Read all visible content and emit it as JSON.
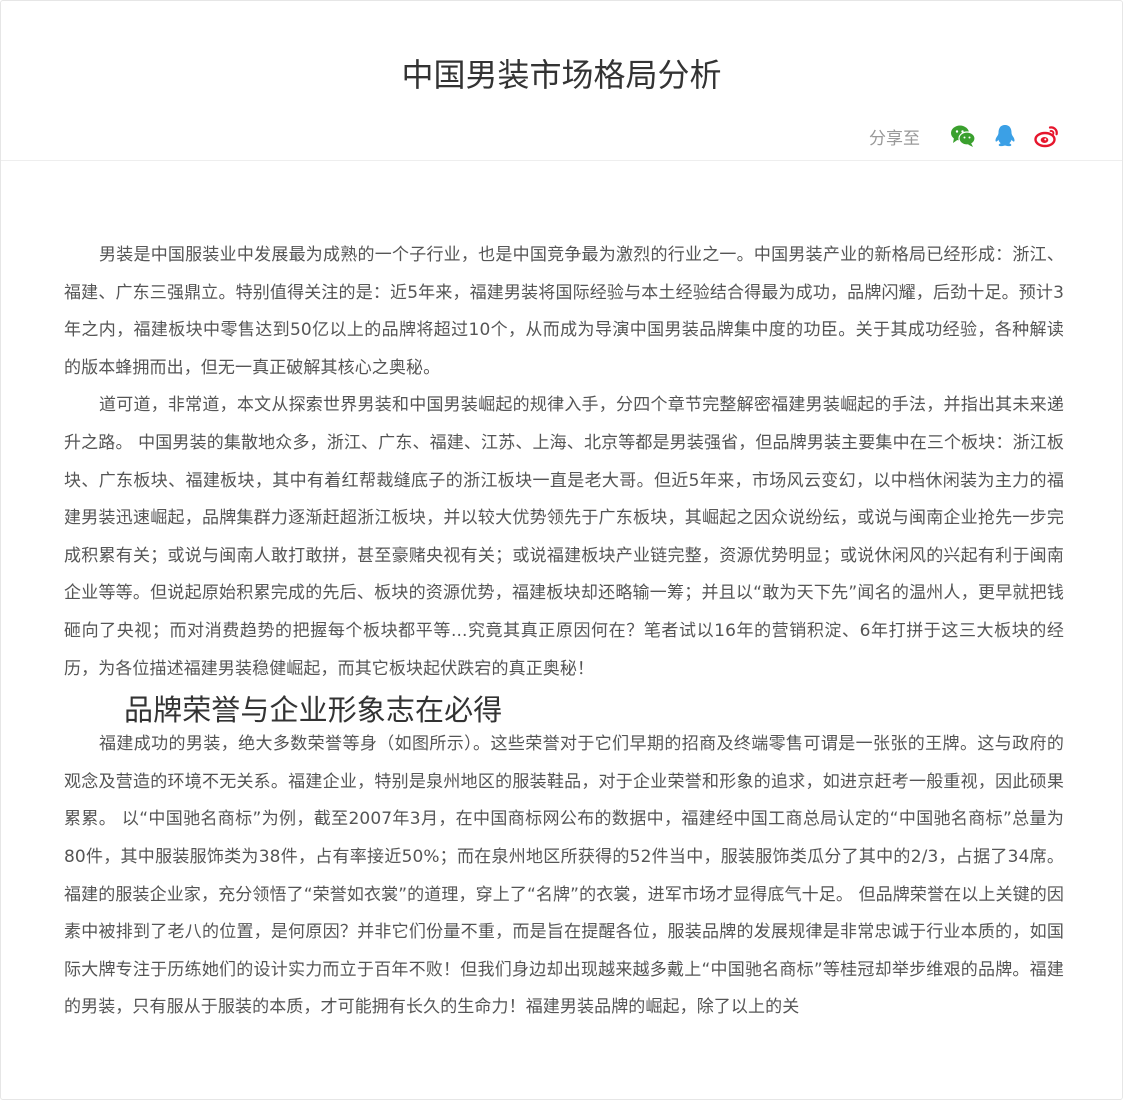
{
  "article": {
    "title": "中国男装市场格局分析",
    "share_label": "分享至",
    "paragraphs": [
      "男装是中国服装业中发展最为成熟的一个子行业，也是中国竞争最为激烈的行业之一。中国男装产业的新格局已经形成：浙江、福建、广东三强鼎立。特别值得关注的是：近5年来，福建男装将国际经验与本土经验结合得最为成功，品牌闪耀，后劲十足。预计3年之内，福建板块中零售达到50亿以上的品牌将超过10个，从而成为导演中国男装品牌集中度的功臣。关于其成功经验，各种解读的版本蜂拥而出，但无一真正破解其核心之奥秘。",
      "道可道，非常道，本文从探索世界男装和中国男装崛起的规律入手，分四个章节完整解密福建男装崛起的手法，并指出其未来递升之路。 中国男装的集散地众多，浙江、广东、福建、江苏、上海、北京等都是男装强省，但品牌男装主要集中在三个板块：浙江板块、广东板块、福建板块，其中有着红帮裁缝底子的浙江板块一直是老大哥。但近5年来，市场风云变幻，以中档休闲装为主力的福建男装迅速崛起，品牌集群力逐渐赶超浙江板块，并以较大优势领先于广东板块，其崛起之因众说纷纭，或说与闽南企业抢先一步完成积累有关；或说与闽南人敢打敢拼，甚至豪赌央视有关；或说福建板块产业链完整，资源优势明显；或说休闲风的兴起有利于闽南企业等等。但说起原始积累完成的先后、板块的资源优势，福建板块却还略输一筹；并且以“敢为天下先”闻名的温州人，更早就把钱砸向了央视；而对消费趋势的把握每个板块都平等...究竟其真正原因何在？笔者试以16年的营销积淀、6年打拼于这三大板块的经历，为各位描述福建男装稳健崛起，而其它板块起伏跌宕的真正奥秘！"
    ],
    "section_heading": "品牌荣誉与企业形象志在必得",
    "section_paragraph": "福建成功的男装，绝大多数荣誉等身（如图所示）。这些荣誉对于它们早期的招商及终端零售可谓是一张张的王牌。这与政府的观念及营造的环境不无关系。福建企业，特别是泉州地区的服装鞋品，对于企业荣誉和形象的追求，如进京赶考一般重视，因此硕果累累。 以“中国驰名商标”为例，截至2007年3月，在中国商标网公布的数据中，福建经中国工商总局认定的“中国驰名商标”总量为80件，其中服装服饰类为38件，占有率接近50%；而在泉州地区所获得的52件当中，服装服饰类瓜分了其中的2/3，占据了34席。福建的服装企业家，充分领悟了“荣誉如衣裳”的道理，穿上了“名牌”的衣裳，进军市场才显得底气十足。 但品牌荣誉在以上关键的因素中被排到了老八的位置，是何原因？并非它们份量不重，而是旨在提醒各位，服装品牌的发展规律是非常忠诚于行业本质的，如国际大牌专注于历练她们的设计实力而立于百年不败！但我们身边却出现越来越多戴上“中国驰名商标”等桂冠却举步维艰的品牌。福建的男装，只有服从于服装的本质，才可能拥有长久的生命力！福建男装品牌的崛起，除了以上的关"
  },
  "icons": {
    "wechat": "wechat-icon",
    "qq": "qq-icon",
    "weibo": "weibo-icon"
  },
  "colors": {
    "wechat": "#3aa02e",
    "qq": "#3ba0e6",
    "weibo": "#e6162d"
  }
}
